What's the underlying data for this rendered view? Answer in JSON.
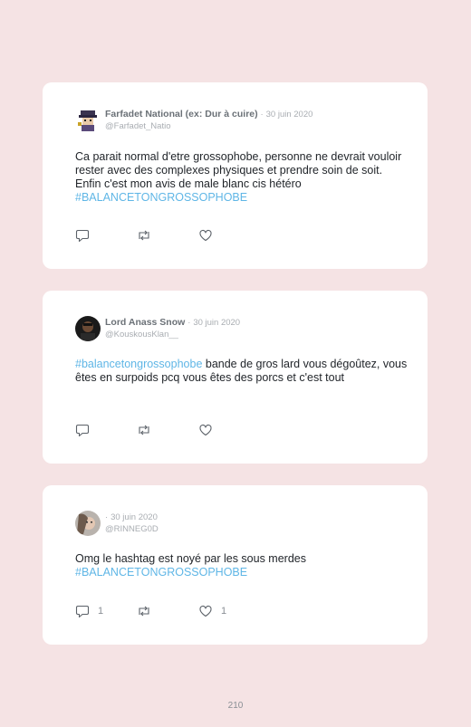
{
  "tweets": [
    {
      "name": "Farfadet National (ex: Dur à cuire)",
      "separator": "·",
      "date": "30 juin 2020",
      "handle": "@Farfadet_Natio",
      "text": "Ca parait normal d'etre grossophobe, personne ne devrait vouloir rester avec des complexes physiques et prendre soin de soit. Enfin c'est mon avis de male blanc cis hétéro",
      "hashtag": "#BALANCETONGROSSOPHOBE",
      "reply_count": "",
      "like_count": ""
    },
    {
      "name": "Lord Anass Snow",
      "separator": "·",
      "date": "30 juin 2020",
      "handle": "@KouskousKlan__",
      "hashtag": "#balancetongrossophobe",
      "text": " bande de gros lard vous dégoûtez, vous êtes en surpoids pcq vous êtes des porcs et c'est tout",
      "reply_count": "",
      "like_count": ""
    },
    {
      "name": "",
      "separator": "·",
      "date": "30 juin 2020",
      "handle": "@RINNEG0D",
      "text": "Omg le hashtag est noyé par les sous merdes",
      "hashtag": "#BALANCETONGROSSOPHOBE",
      "reply_count": "1",
      "like_count": "1"
    }
  ],
  "icons": {
    "reply": "reply-icon",
    "retweet": "retweet-icon",
    "like": "heart-icon"
  },
  "page_number": "210"
}
